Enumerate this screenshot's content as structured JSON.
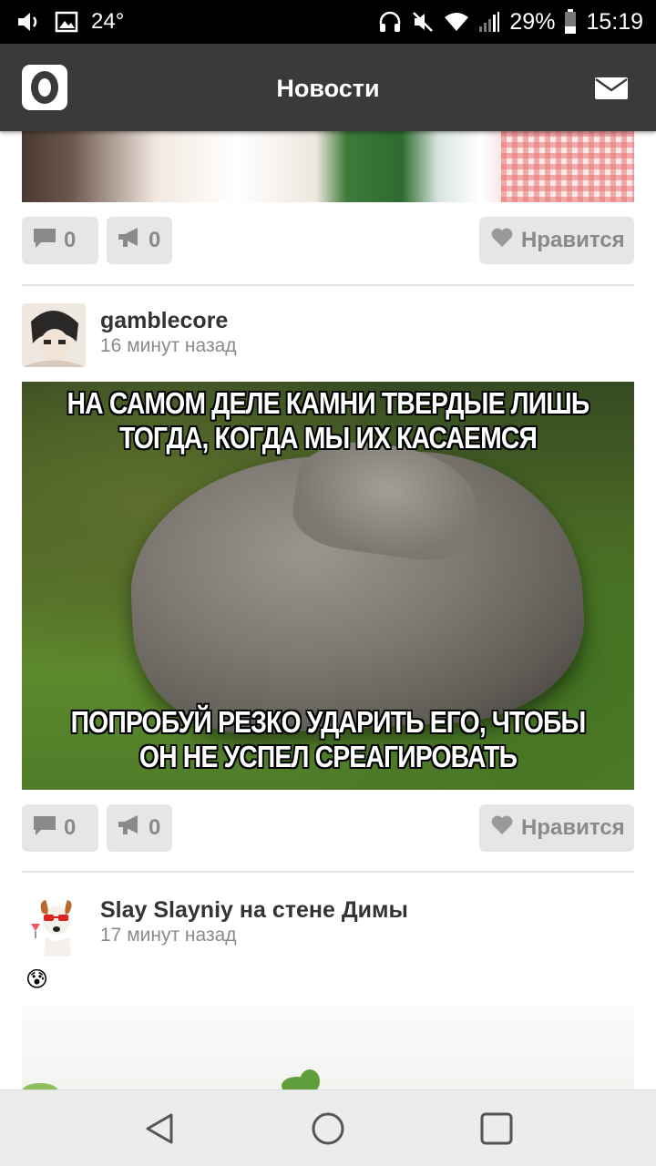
{
  "status_bar": {
    "temperature": "24°",
    "battery": "29%",
    "time": "15:19",
    "icons": [
      "volume-icon",
      "image-icon",
      "headphones-icon",
      "mute-icon",
      "wifi-icon",
      "signal-icon",
      "battery-icon"
    ]
  },
  "header": {
    "title": "Новости",
    "logo_icon": "odnoklassniki-logo",
    "mail_icon": "mail-icon"
  },
  "feed": [
    {
      "actions": {
        "comments": "0",
        "shares": "0",
        "like_label": "Нравится"
      }
    },
    {
      "author": "gamblecore",
      "time": "16 минут назад",
      "meme_top": "НА САМОМ ДЕЛЕ КАМНИ ТВЕРДЫЕ ЛИШЬ ТОГДА, КОГДА МЫ ИХ КАСАЕМСЯ",
      "meme_bottom": "ПОПРОБУЙ РЕЗКО УДАРИТЬ ЕГО, ЧТОБЫ ОН НЕ УСПЕЛ СРЕАГИРОВАТЬ",
      "actions": {
        "comments": "0",
        "shares": "0",
        "like_label": "Нравится"
      }
    },
    {
      "author": "Slay Slayniy на стене Димы",
      "time": "17 минут назад",
      "emoji": "😰"
    }
  ],
  "nav": {
    "icons": [
      "back-icon",
      "home-icon",
      "recents-icon"
    ]
  },
  "colors": {
    "header_bg": "#3a3a3a",
    "status_bg": "#000000",
    "pill_bg": "#e6e6e6",
    "pill_text": "#8a8a8a"
  }
}
